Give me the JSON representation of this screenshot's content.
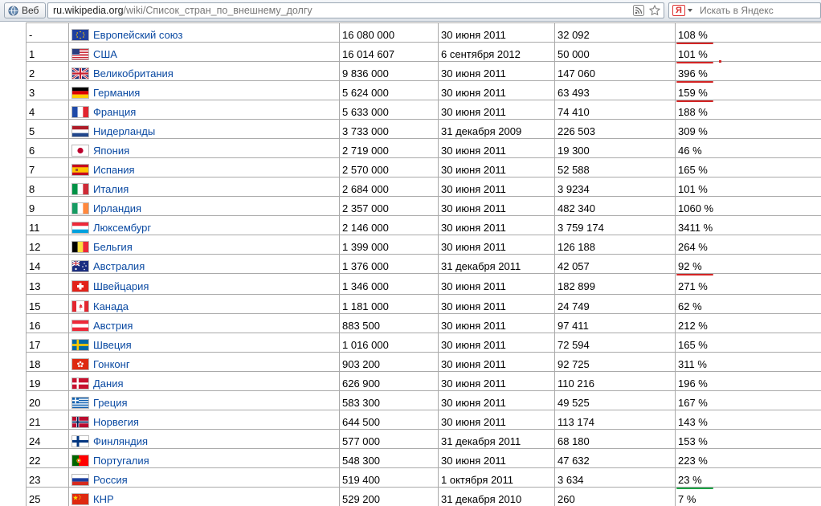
{
  "browser": {
    "web_button_label": "Веб",
    "url_domain": "ru.wikipedia.org",
    "url_path": "/wiki/Список_стран_по_внешнему_долгу",
    "search_logo": "Я",
    "search_placeholder": "Искать в Яндекс",
    "icons": [
      "globe-icon",
      "rss-icon",
      "star-icon",
      "yandex-icon"
    ]
  },
  "table": {
    "rows": [
      {
        "rank": "-",
        "country": "Европейский союз",
        "flag": "eu",
        "debt": "16 080 000",
        "date": "30 июня 2011",
        "per_capita": "32 092",
        "pct": "108 %",
        "mark": "red"
      },
      {
        "rank": "1",
        "country": "США",
        "flag": "us",
        "debt": "16 014 607",
        "date": "6 сентября 2012",
        "per_capita": "50 000",
        "pct": "101 %",
        "mark": "red"
      },
      {
        "rank": "2",
        "country": "Великобритания",
        "flag": "gb",
        "debt": "9 836 000",
        "date": "30 июня 2011",
        "per_capita": "147 060",
        "pct": "396 %",
        "mark": "red"
      },
      {
        "rank": "3",
        "country": "Германия",
        "flag": "de",
        "debt": "5 624 000",
        "date": "30 июня 2011",
        "per_capita": "63 493",
        "pct": "159 %",
        "mark": "red"
      },
      {
        "rank": "4",
        "country": "Франция",
        "flag": "fr",
        "debt": "5 633 000",
        "date": "30 июня 2011",
        "per_capita": "74 410",
        "pct": "188 %",
        "mark": ""
      },
      {
        "rank": "5",
        "country": "Нидерланды",
        "flag": "nl",
        "debt": "3 733 000",
        "date": "31 декабря 2009",
        "per_capita": "226 503",
        "pct": "309 %",
        "mark": ""
      },
      {
        "rank": "6",
        "country": "Япония",
        "flag": "jp",
        "debt": "2 719 000",
        "date": "30 июня 2011",
        "per_capita": "19 300",
        "pct": "46 %",
        "mark": ""
      },
      {
        "rank": "7",
        "country": "Испания",
        "flag": "es",
        "debt": "2 570 000",
        "date": "30 июня 2011",
        "per_capita": "52 588",
        "pct": "165 %",
        "mark": ""
      },
      {
        "rank": "8",
        "country": "Италия",
        "flag": "it",
        "debt": "2 684 000",
        "date": "30 июня 2011",
        "per_capita": "3 9234",
        "pct": "101 %",
        "mark": ""
      },
      {
        "rank": "9",
        "country": "Ирландия",
        "flag": "ie",
        "debt": "2 357 000",
        "date": "30 июня 2011",
        "per_capita": "482 340",
        "pct": "1060 %",
        "mark": ""
      },
      {
        "rank": "11",
        "country": "Люксембург",
        "flag": "lu",
        "debt": "2 146 000",
        "date": "30 июня 2011",
        "per_capita": "3 759 174",
        "pct": "3411 %",
        "mark": ""
      },
      {
        "rank": "12",
        "country": "Бельгия",
        "flag": "be",
        "debt": "1 399 000",
        "date": "30 июня 2011",
        "per_capita": "126 188",
        "pct": "264 %",
        "mark": ""
      },
      {
        "rank": "14",
        "country": "Австралия",
        "flag": "au",
        "debt": "1 376 000",
        "date": "31 декабря 2011",
        "per_capita": "42 057",
        "pct": "92 %",
        "mark": "red"
      },
      {
        "rank": "13",
        "country": "Швейцария",
        "flag": "ch",
        "debt": "1 346 000",
        "date": "30 июня 2011",
        "per_capita": "182 899",
        "pct": "271 %",
        "mark": "",
        "tall": true
      },
      {
        "rank": "15",
        "country": "Канада",
        "flag": "ca",
        "debt": "1 181 000",
        "date": "30 июня 2011",
        "per_capita": "24 749",
        "pct": "62 %",
        "mark": ""
      },
      {
        "rank": "16",
        "country": "Австрия",
        "flag": "at",
        "debt": "883 500",
        "date": "30 июня 2011",
        "per_capita": "97 411",
        "pct": "212 %",
        "mark": ""
      },
      {
        "rank": "17",
        "country": "Швеция",
        "flag": "se",
        "debt": "1 016 000",
        "date": "30 июня 2011",
        "per_capita": "72 594",
        "pct": "165 %",
        "mark": ""
      },
      {
        "rank": "18",
        "country": "Гонконг",
        "flag": "hk",
        "debt": "903 200",
        "date": "30 июня 2011",
        "per_capita": "92 725",
        "pct": "311 %",
        "mark": ""
      },
      {
        "rank": "19",
        "country": "Дания",
        "flag": "dk",
        "debt": "626 900",
        "date": "30 июня 2011",
        "per_capita": "110 216",
        "pct": "196 %",
        "mark": ""
      },
      {
        "rank": "20",
        "country": "Греция",
        "flag": "gr",
        "debt": "583 300",
        "date": "30 июня 2011",
        "per_capita": "49 525",
        "pct": "167 %",
        "mark": ""
      },
      {
        "rank": "21",
        "country": "Норвегия",
        "flag": "no",
        "debt": "644 500",
        "date": "30 июня 2011",
        "per_capita": "113 174",
        "pct": "143 %",
        "mark": ""
      },
      {
        "rank": "24",
        "country": "Финляндия",
        "flag": "fi",
        "debt": "577 000",
        "date": "31 декабря 2011",
        "per_capita": "68 180",
        "pct": "153 %",
        "mark": ""
      },
      {
        "rank": "22",
        "country": "Португалия",
        "flag": "pt",
        "debt": "548 300",
        "date": "30 июня 2011",
        "per_capita": "47 632",
        "pct": "223 %",
        "mark": ""
      },
      {
        "rank": "23",
        "country": "Россия",
        "flag": "ru",
        "debt": "519 400",
        "date": "1 октября 2011",
        "per_capita": "3 634",
        "pct": "23 %",
        "mark": "green"
      },
      {
        "rank": "25",
        "country": "КНР",
        "flag": "cn",
        "debt": "529 200",
        "date": "31 декабря 2010",
        "per_capita": "260",
        "pct": "7 %",
        "mark": "green"
      }
    ]
  },
  "colors": {
    "link": "#0b4aa2",
    "red_mark": "#d32424",
    "green_mark": "#1ca245",
    "border": "#aaaaaa"
  }
}
